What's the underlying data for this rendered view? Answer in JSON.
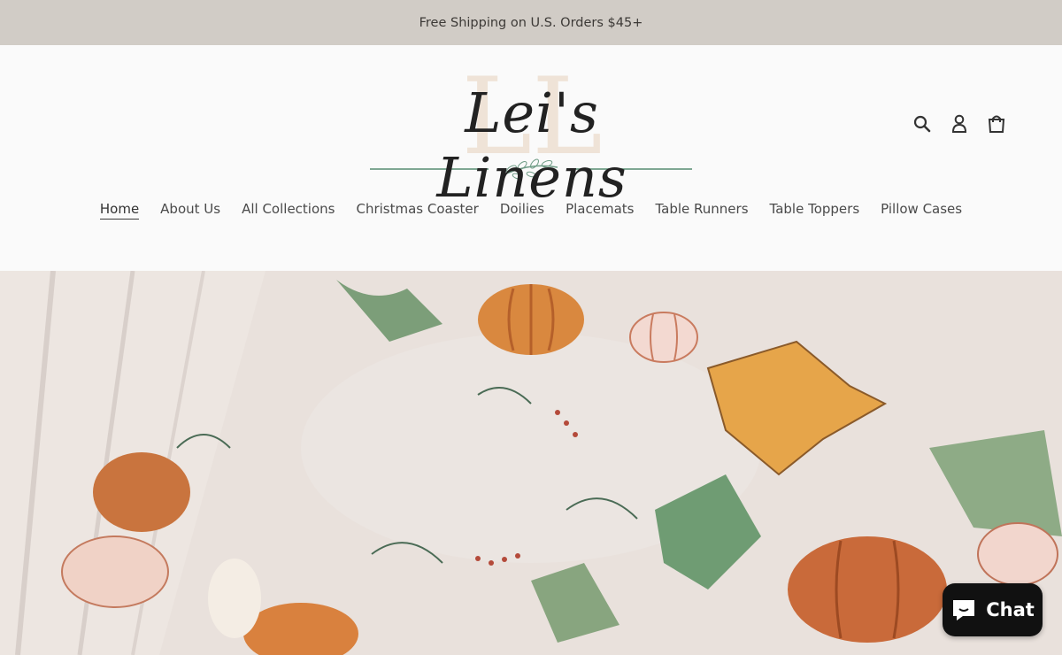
{
  "announcement": {
    "text": "Free Shipping on U.S. Orders $45+"
  },
  "brand": {
    "name": "Lei's Linens",
    "monogram": "LL"
  },
  "header_icons": [
    {
      "icon": "search-icon"
    },
    {
      "icon": "account-icon"
    },
    {
      "icon": "cart-icon"
    }
  ],
  "nav": {
    "items": [
      {
        "label": "Home",
        "active": true
      },
      {
        "label": "About Us"
      },
      {
        "label": "All Collections"
      },
      {
        "label": "Christmas Coaster"
      },
      {
        "label": "Doilies"
      },
      {
        "label": "Placemats"
      },
      {
        "label": "Table Runners"
      },
      {
        "label": "Table Toppers"
      },
      {
        "label": "Pillow Cases"
      }
    ]
  },
  "chat": {
    "label": "Chat",
    "icon": "chat-bubble-icon"
  },
  "colors": {
    "announcement_bg": "#d1ccc6",
    "header_bg": "#fafafa",
    "chat_bg": "#111111",
    "logo_accent": "#6f9c86"
  }
}
